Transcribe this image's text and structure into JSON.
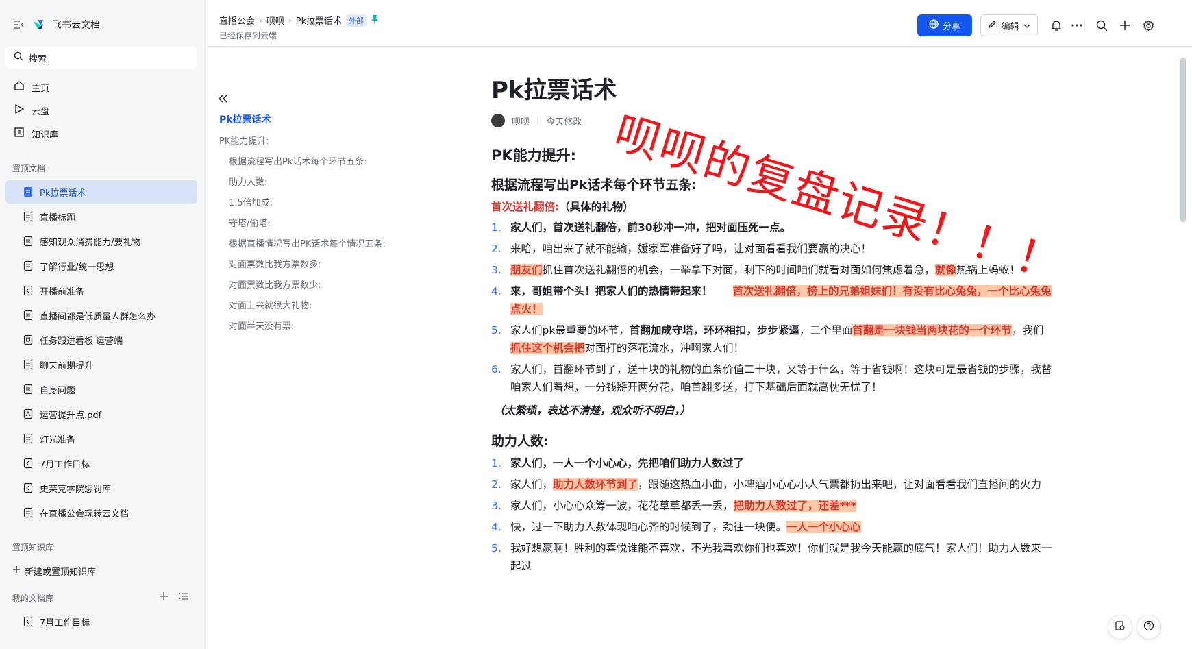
{
  "app": {
    "name": "飞书云文档"
  },
  "sidebar": {
    "search_label": "搜索",
    "nav": [
      {
        "label": "主页",
        "icon": "home-icon"
      },
      {
        "label": "云盘",
        "icon": "cloud-drive-icon"
      },
      {
        "label": "知识库",
        "icon": "knowledge-base-icon"
      }
    ],
    "pinned_docs_label": "置顶文档",
    "pinned_docs": [
      {
        "label": "Pk拉票话术",
        "active": true
      },
      {
        "label": "直播标题"
      },
      {
        "label": "感知观众消费能力/要礼物"
      },
      {
        "label": "了解行业/统一思想"
      },
      {
        "label": "开播前准备"
      },
      {
        "label": "直播间都是低质量人群怎么办"
      },
      {
        "label": "任务跟进看板 运营端"
      },
      {
        "label": "聊天前期提升"
      },
      {
        "label": "自身问题"
      },
      {
        "label": "运营提升点.pdf"
      },
      {
        "label": "灯光准备"
      },
      {
        "label": "7月工作目标"
      },
      {
        "label": "史莱克学院惩罚库"
      },
      {
        "label": "在直播公会玩转云文档"
      }
    ],
    "pinned_kb_label": "置顶知识库",
    "new_kb_label": "新建或置顶知识库",
    "my_library_label": "我的文档库",
    "my_library_items": [
      {
        "label": "7月工作目标"
      }
    ]
  },
  "header": {
    "breadcrumbs": [
      "直播公会",
      "呗呗",
      "Pk拉票话术"
    ],
    "external_badge": "外部",
    "saved_status": "已经保存到云端",
    "share_label": "分享",
    "edit_label": "编辑"
  },
  "toc": {
    "items": [
      {
        "label": "Pk拉票话术"
      },
      {
        "label": "PK能力提升:"
      },
      {
        "label": "根据流程写出Pk话术每个环节五条:"
      },
      {
        "label": "助力人数:"
      },
      {
        "label": "1.5倍加成:"
      },
      {
        "label": "守塔/偷塔:"
      },
      {
        "label": "根据直播情况写出PK话术每个情况五条:"
      },
      {
        "label": "对面票数比我方票数多:"
      },
      {
        "label": "对面票数比我方票数少:"
      },
      {
        "label": "对面上来就很大礼物:"
      },
      {
        "label": "对面半天没有票:"
      }
    ]
  },
  "doc": {
    "title": "Pk拉票话术",
    "author": "呗呗",
    "modified": "今天修改",
    "overlay_text": "呗呗的复盘记录！！！",
    "h2_1": "PK能力提升:",
    "h3_1": "根据流程写出Pk话术每个环节五条:",
    "sub1_red": "首次送礼翻倍:",
    "sub1_rest": "（具体的礼物）",
    "list1": {
      "i1": "家人们，首次送礼翻倍，前30秒冲一冲，把对面压死一点。",
      "i2": "来哈，咱出来了就不能输，嫒家军准备好了吗，让对面看看我们要赢的决心！",
      "i3_a": "朋友们",
      "i3_b": "抓住首次送礼翻倍的机会，一举拿下对面，剩下的时间咱们就看对面如何焦虑着急，",
      "i3_c": "就像",
      "i3_d": "热锅上蚂蚁！",
      "i4_a": "来，哥姐带个头！把家人们的热情带起来！",
      "i4_b": "首次送礼翻倍，榜上的兄弟姐妹们！有没有比心兔兔，一个比心兔兔点火！",
      "i5_a": "家人们pk最重要的环节，",
      "i5_b": "首翻加成守塔，环环相扣，步步紧逼",
      "i5_c": "，三个里面",
      "i5_d": "首翻是一块钱当两块花的一个环节",
      "i5_e": "，我们",
      "i5_f": "抓住这个机会把",
      "i5_g": "对面打的落花流水，冲啊家人们！",
      "i6": "家人们，首翻环节到了，送十块的礼物的血条价值二十块，又等于什么，等于省钱啊！这块可是最省钱的步骤，我替咱家人们着想，一分钱掰开两分花，咱首翻多送，打下基础后面就高枕无忧了！"
    },
    "note": "（太繁琐，表达不清楚，观众听不明白，）",
    "h3_2": "助力人数:",
    "list2": {
      "i1": "家人们，一人一个小心心，先把咱们助力人数过了",
      "i2_a": "家人们，",
      "i2_b": "助力人数环节到了",
      "i2_c": "，跟随这热血小曲，小啤酒小心心小人气票都扔出来吧，让对面看看我们直播间的火力",
      "i3_a": "家人们，小心心众筹一波，花花草草都丢一丢，",
      "i3_b": "把助力人数过了，还差***",
      "i4_a": "快，过一下助力人数体现咱心齐的时候到了，劲往一块使。",
      "i4_b": "一人一个小心心",
      "i5": "我好想赢啊！胜利的喜悦谁能不喜欢，不光我喜欢你们也喜欢！你们就是我今天能赢的底气！家人们！助力人数来一起过"
    }
  },
  "colors": {
    "accent": "#1456f0",
    "highlight_bg": "#ffc9a8",
    "highlight_text": "#d83931"
  }
}
